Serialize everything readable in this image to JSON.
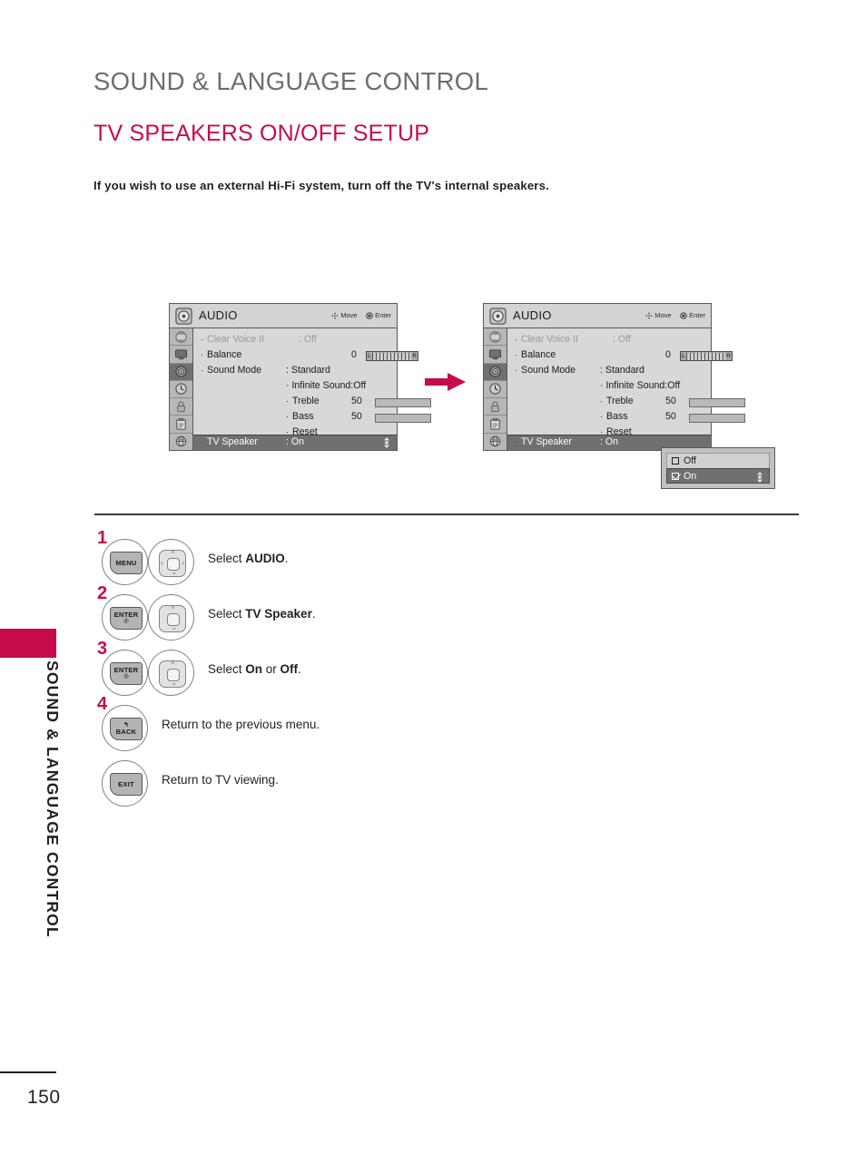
{
  "page": {
    "chapter_title": "SOUND & LANGUAGE CONTROL",
    "section_title": "TV SPEAKERS ON/OFF SETUP",
    "intro": "If you wish to use an external Hi-Fi system, turn off the TV's internal speakers.",
    "side_tab_label": "SOUND & LANGUAGE CONTROL",
    "page_number": "150",
    "accent_color": "#c60b4d",
    "chapter_color": "#6d6e71",
    "text_color": "#231f20"
  },
  "osd": {
    "title": "AUDIO",
    "header_icon": "audio-disc-icon",
    "hints": [
      {
        "icon": "move-dpad-icon",
        "label": "Move"
      },
      {
        "icon": "enter-dot-icon",
        "label": "Enter"
      }
    ],
    "rail_icons": [
      "setup-satellite-icon",
      "picture-tv-icon",
      "audio-speaker-icon",
      "time-clock-icon",
      "lock-padlock-icon",
      "option-clipboard-icon",
      "network-globe-icon"
    ],
    "rail_active_index": 2,
    "rows": [
      {
        "label": "Clear Voice II",
        "value": ": Off",
        "dim": true,
        "type": "text"
      },
      {
        "label": "Balance",
        "value": "0",
        "dim": false,
        "type": "balance",
        "left_mark": "L",
        "right_mark": "R"
      },
      {
        "label": "Sound Mode",
        "value": ": Standard",
        "dim": false,
        "type": "text"
      },
      {
        "label": "",
        "value": "· Infinite Sound:Off",
        "dim": false,
        "type": "plain"
      },
      {
        "label": "Treble",
        "value": "50",
        "dim": false,
        "type": "slider",
        "fill": 55,
        "indent": true
      },
      {
        "label": "Bass",
        "value": "50",
        "dim": false,
        "type": "slider",
        "fill": 55,
        "indent": true
      },
      {
        "label": "Reset",
        "value": "",
        "dim": false,
        "type": "text",
        "indent": true
      },
      {
        "label": "TV Speaker",
        "value": ": On",
        "dim": false,
        "type": "text",
        "selected": true
      }
    ]
  },
  "dropdown": {
    "options": [
      {
        "label": "Off",
        "checked": false,
        "selected": false
      },
      {
        "label": "On",
        "checked": true,
        "selected": true
      }
    ]
  },
  "flow_arrow": {
    "name": "right-arrow-icon",
    "color": "#c60b4d"
  },
  "steps": [
    {
      "number": "1",
      "button1": {
        "name": "menu-button",
        "label": "MENU",
        "sub": ""
      },
      "button2": {
        "name": "dpad-4way-button",
        "arrows": "up-down-left-right"
      },
      "text_prefix": "Select ",
      "text_bold": "AUDIO",
      "text_suffix": "."
    },
    {
      "number": "2",
      "button1": {
        "name": "enter-button",
        "label": "ENTER",
        "sub": "®"
      },
      "button2": {
        "name": "dpad-updown-button",
        "arrows": "up-down"
      },
      "text_prefix": "Select ",
      "text_bold": "TV Speaker",
      "text_suffix": "."
    },
    {
      "number": "3",
      "button1": {
        "name": "enter-button",
        "label": "ENTER",
        "sub": "®"
      },
      "button2": {
        "name": "dpad-updown-button",
        "arrows": "up-down"
      },
      "text_prefix": "Select ",
      "text_bold": "On",
      "text_mid": " or ",
      "text_bold2": "Off",
      "text_suffix": "."
    },
    {
      "number": "4",
      "button1": {
        "name": "back-button",
        "label": "BACK",
        "sub": ""
      },
      "button2": null,
      "text_prefix": "Return to the previous menu.",
      "text_bold": "",
      "text_suffix": ""
    },
    {
      "number": "",
      "button1": {
        "name": "exit-button",
        "label": "EXIT",
        "sub": ""
      },
      "button2": null,
      "text_prefix": "Return to TV viewing.",
      "text_bold": "",
      "text_suffix": ""
    }
  ]
}
